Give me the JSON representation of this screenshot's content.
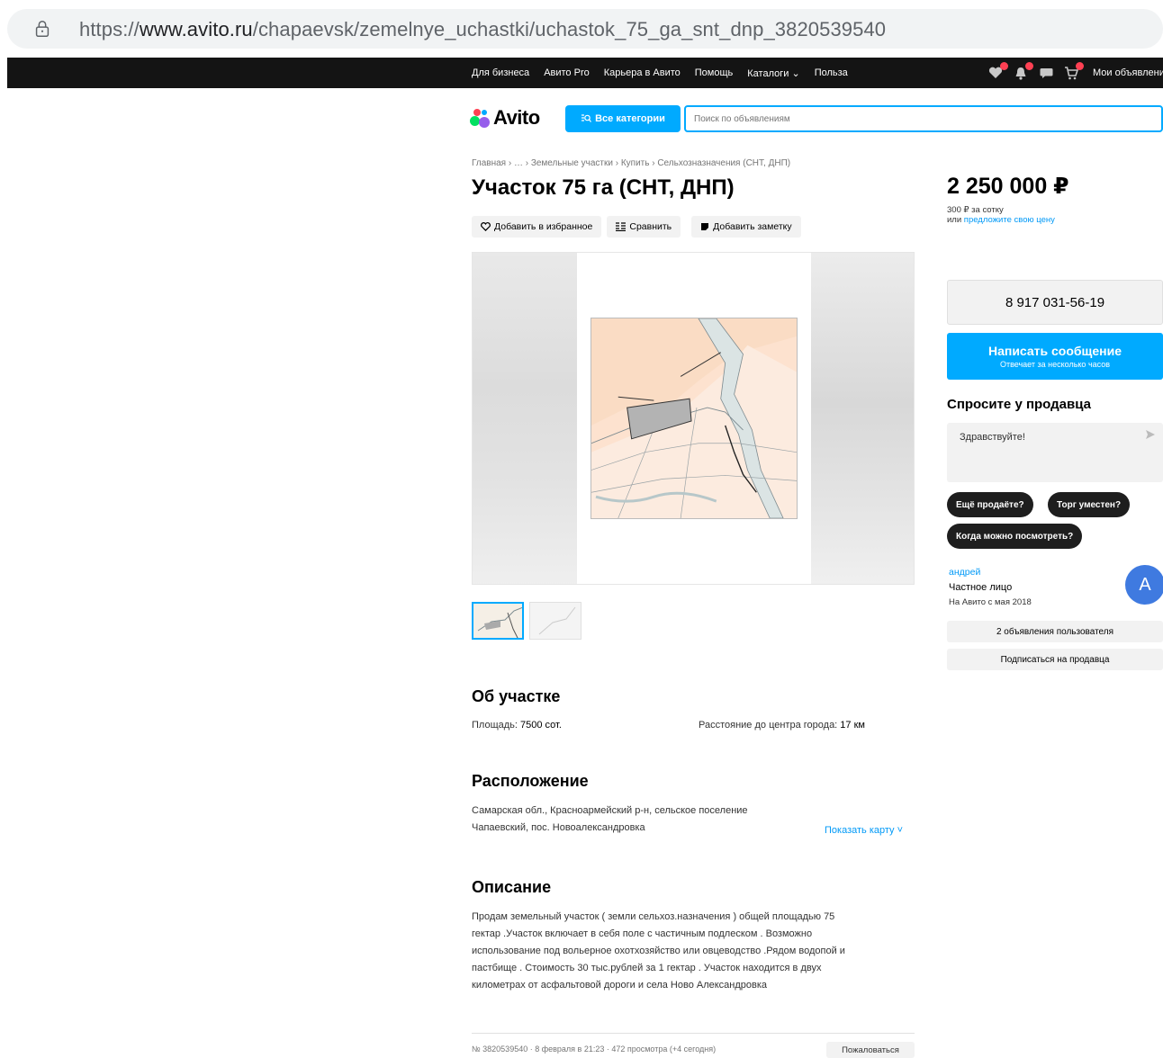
{
  "browser": {
    "url_prefix": "https://",
    "url_host": "www.avito.ru",
    "url_path": "/chapaevsk/zemelnye_uchastki/uchastok_75_ga_snt_dnp_3820539540"
  },
  "topbar": {
    "items": [
      "Для бизнеса",
      "Авито Pro",
      "Карьера в Авито",
      "Помощь",
      "Каталоги",
      "Польза"
    ],
    "catalog_chevron": "⌄",
    "my_ads": "Мои объявления",
    "icons": [
      "heart-icon",
      "bell-icon",
      "chat-icon",
      "cart-icon"
    ]
  },
  "header": {
    "logo_text": "Avito",
    "categories_button": "Все категории",
    "search_placeholder": "Поиск по объявлениям"
  },
  "breadcrumb": "Главная › … › Земельные участки › Купить › Сельхозназначения (СНТ, ДНП)",
  "listing": {
    "title": "Участок 75 га (СНТ, ДНП)",
    "actions": {
      "favorite": "Добавить в избранное",
      "compare": "Сравнить",
      "note": "Добавить заметку"
    }
  },
  "about": {
    "heading": "Об участке",
    "area_label": "Площадь: ",
    "area_value": "7500 сот.",
    "distance_label": "Расстояние до центра города: ",
    "distance_value": "17 км"
  },
  "location": {
    "heading": "Расположение",
    "line1": "Самарская обл., Красноармейский р-н, сельское поселение",
    "line2": "Чапаевский, пос. Новоалександровка",
    "show_map": "Показать карту ˅"
  },
  "description": {
    "heading": "Описание",
    "lines": [
      "Продам земельный участок ( земли сельхоз.назначения ) общей площадью 75",
      "гектар .Участок включает в себя поле с частичным подлеском . Возможно",
      "использование под вольерное охотхозяйство или овцеводство .Рядом водопой и",
      "пастбище . Стоимость 30 тыс.рублей за 1 гектар . Участок находится в двух",
      "километрах от асфальтовой дороги и села Ново Александровка"
    ]
  },
  "footer": {
    "meta": "№ 3820539540 · 8 февраля в 21:23 · 472 просмотра (+4 сегодня)",
    "report": "Пожаловаться"
  },
  "sidebar": {
    "price": "2 250 000 ₽",
    "per_unit": "300 ₽ за сотку",
    "offer_prefix": "или ",
    "offer_link": "предложите свою цену",
    "phone": "8 917 031-56-19",
    "message_button": "Написать сообщение",
    "message_sub": "Отвечает за несколько часов",
    "ask_heading": "Спросите у продавца",
    "ask_input": "Здравствуйте!",
    "chips": [
      "Ещё продаёте?",
      "Торг уместен?",
      "Когда можно посмотреть?"
    ],
    "seller_name": "андрей",
    "seller_type": "Частное лицо",
    "seller_since": "На Авито с мая 2018",
    "avatar_letter": "A",
    "user_ads_button": "2 объявления пользователя",
    "subscribe_button": "Подписаться на продавца"
  },
  "colors": {
    "accent": "#00aaff",
    "link": "#0099f7",
    "topbar": "#141414",
    "avatar": "#3f7ae0"
  }
}
